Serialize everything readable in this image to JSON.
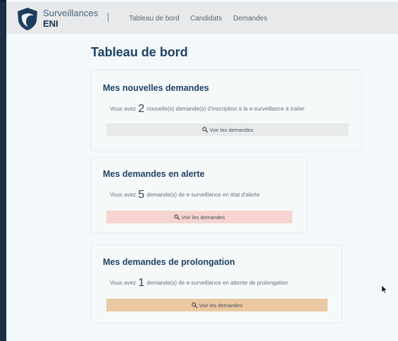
{
  "header": {
    "logo_line1": "Surveillances",
    "logo_line2": "ENI",
    "nav": [
      {
        "label": "Tableau de bord"
      },
      {
        "label": "Candidats"
      },
      {
        "label": "Demandes"
      }
    ]
  },
  "page": {
    "title": "Tableau de bord"
  },
  "cards": [
    {
      "title": "Mes nouvelles demandes",
      "text_before": "Vous avez",
      "count": "2",
      "text_after": "nouvelle(s) demande(s) d'inscription à la e-surveillance à traiter",
      "button_label": "Voir les demandes",
      "button_color": "#e8e9ea"
    },
    {
      "title": "Mes demandes en alerte",
      "text_before": "Vous avez",
      "count": "5",
      "text_after": "demande(s) de e-surveillance en état d'alerte",
      "button_label": "Voir les demandes",
      "button_color": "#f6d4cf"
    },
    {
      "title": "Mes demandes de prolongation",
      "text_before": "Vous avez",
      "count": "1",
      "text_after": "demande(s) de e-surveillance en attente de prolongation",
      "button_label": "Voir les demandes",
      "button_color": "#eac8a2"
    }
  ],
  "icons": {
    "logo": "eagle-shield-logo-icon",
    "button": "search-icon",
    "pointer": "mouse-cursor-icon"
  },
  "colors": {
    "title": "#1e4264",
    "header_bg": "#e7e9eb"
  }
}
